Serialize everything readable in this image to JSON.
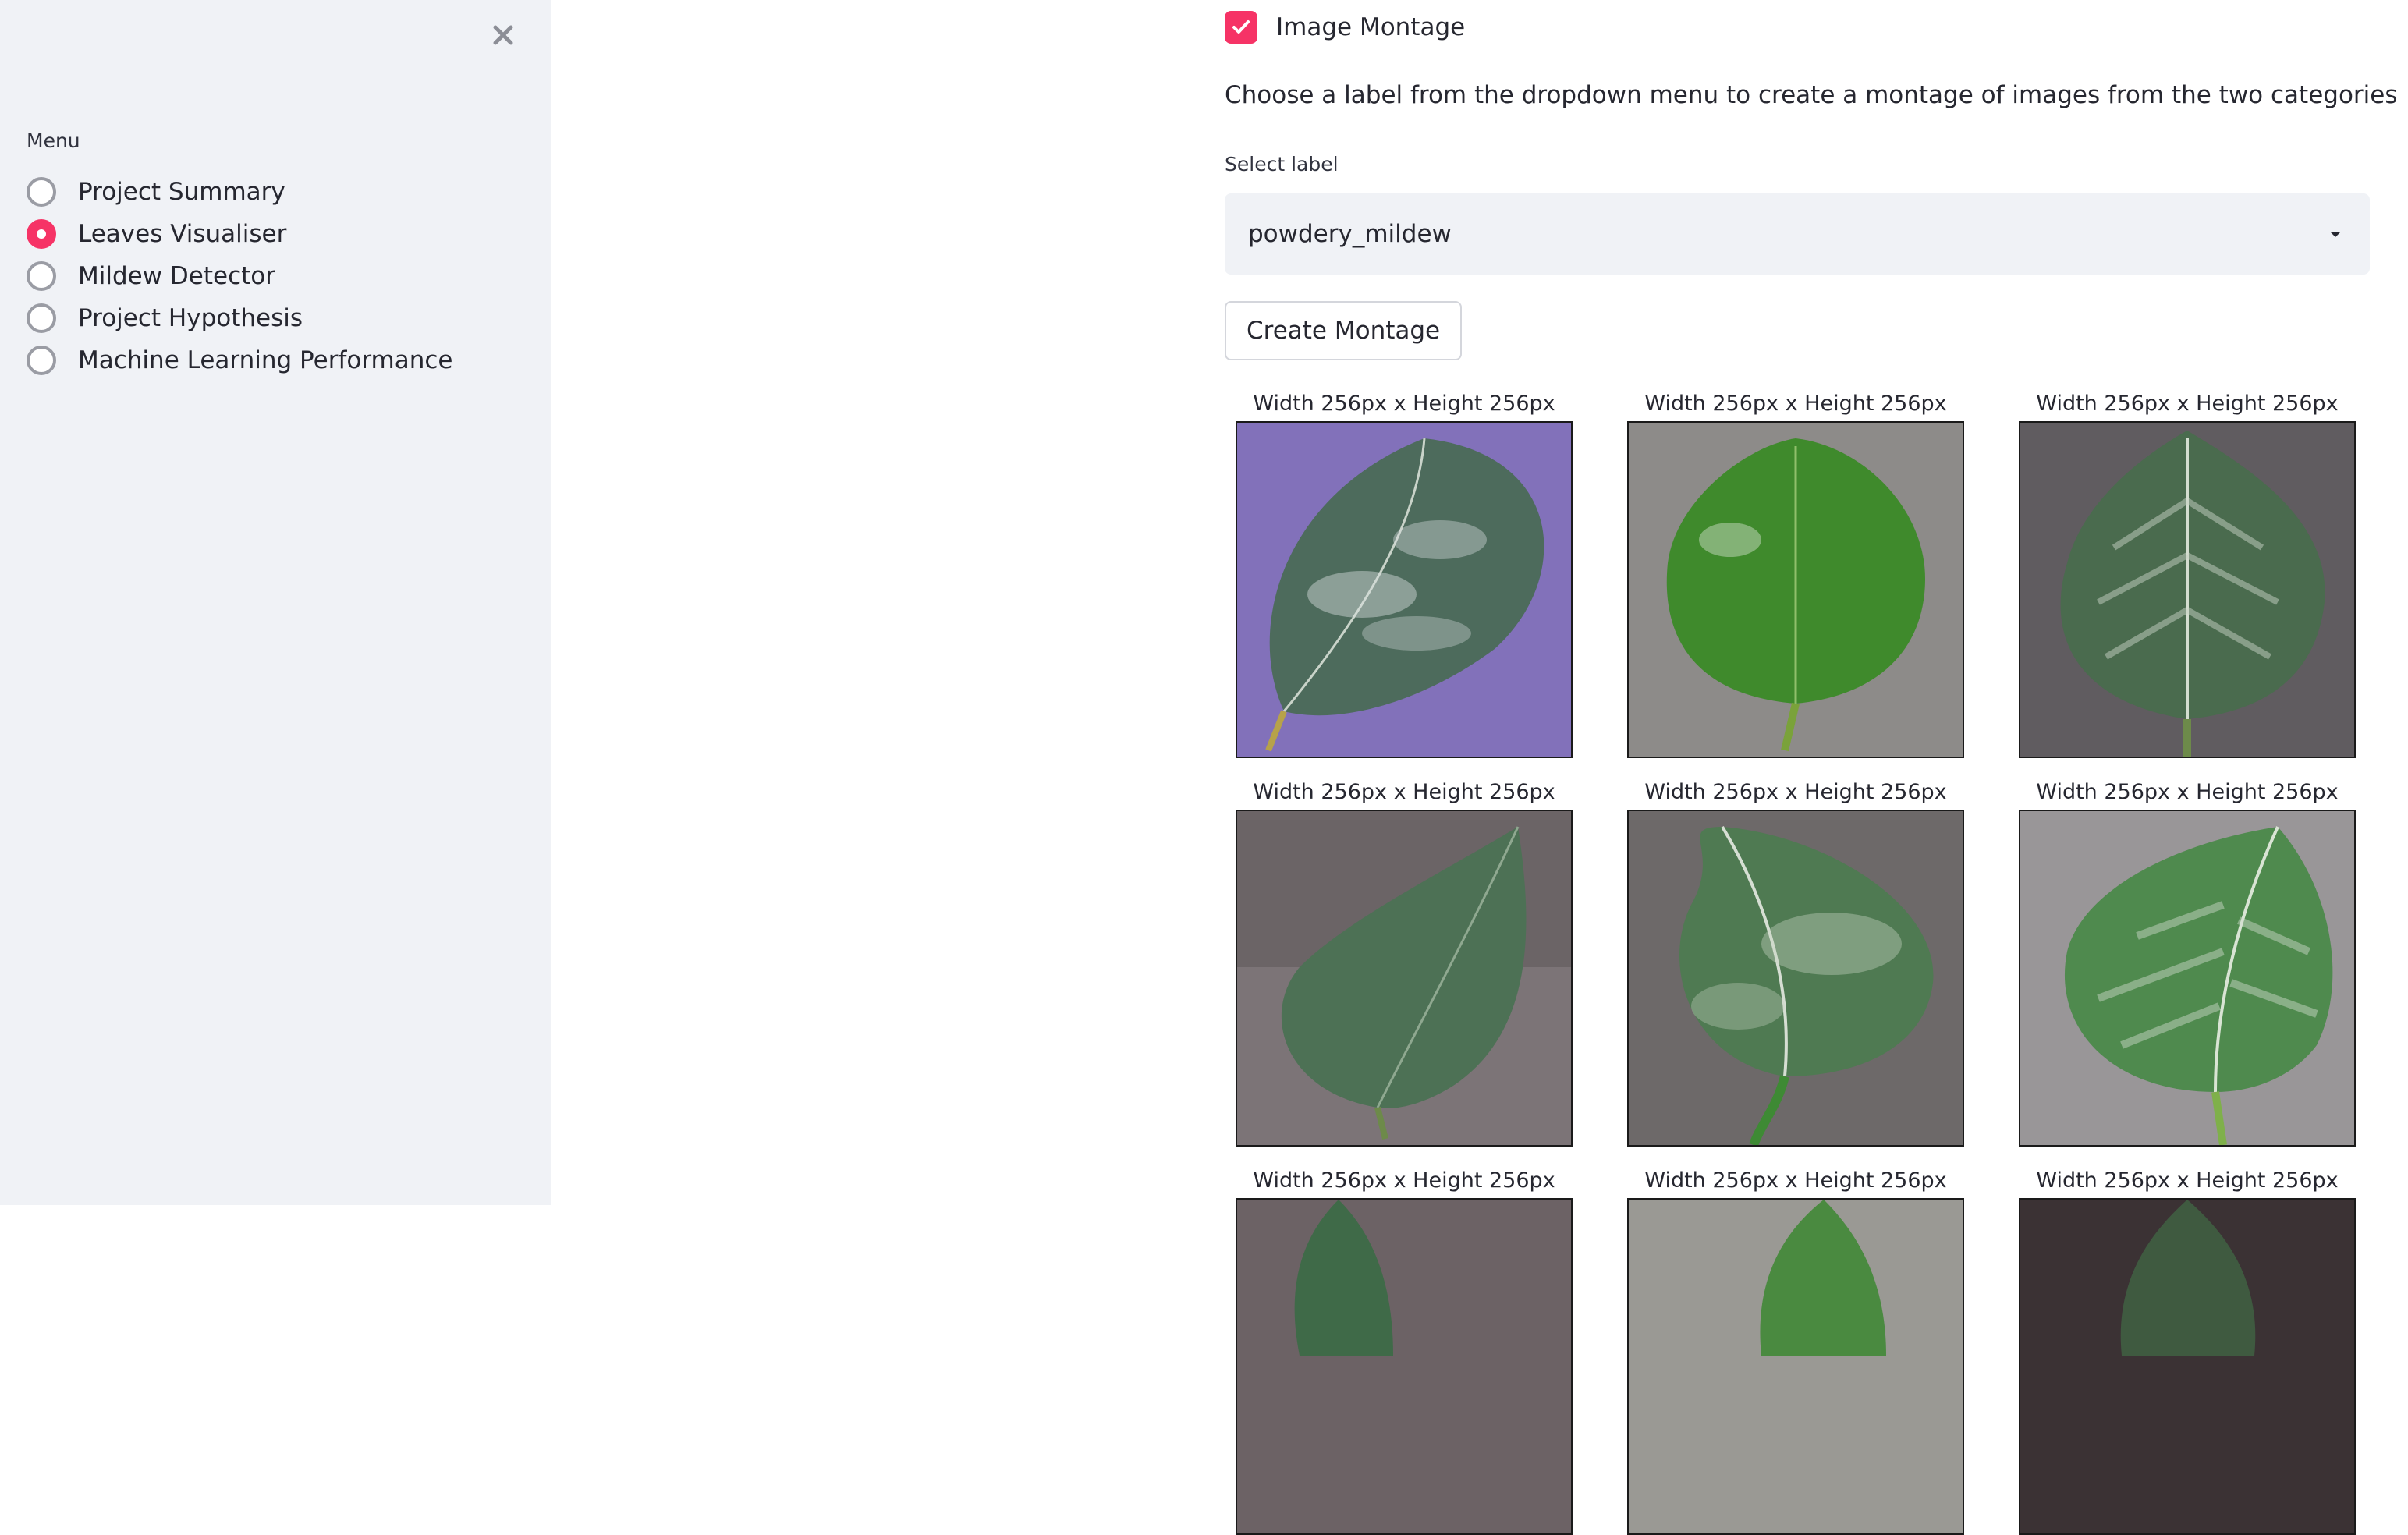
{
  "sidebar": {
    "close_icon": "close-icon",
    "menu_label": "Menu",
    "items": [
      {
        "label": "Project Summary",
        "selected": false
      },
      {
        "label": "Leaves Visualiser",
        "selected": true
      },
      {
        "label": "Mildew Detector",
        "selected": false
      },
      {
        "label": "Project Hypothesis",
        "selected": false
      },
      {
        "label": "Machine Learning Performance",
        "selected": false
      }
    ]
  },
  "main": {
    "checkbox": {
      "label": "Image Montage",
      "checked": true
    },
    "description": "Choose a label from the dropdown menu to create a montage of images from the two categories",
    "select": {
      "label": "Select label",
      "value": "powdery_mildew"
    },
    "button_label": "Create Montage",
    "montage": {
      "caption": "Width 256px x Height 256px",
      "images": [
        {
          "caption": "Width 256px x Height 256px"
        },
        {
          "caption": "Width 256px x Height 256px"
        },
        {
          "caption": "Width 256px x Height 256px"
        },
        {
          "caption": "Width 256px x Height 256px"
        },
        {
          "caption": "Width 256px x Height 256px"
        },
        {
          "caption": "Width 256px x Height 256px"
        },
        {
          "caption": "Width 256px x Height 256px"
        },
        {
          "caption": "Width 256px x Height 256px"
        },
        {
          "caption": "Width 256px x Height 256px"
        }
      ]
    }
  },
  "colors": {
    "accent": "#f63366",
    "sidebar_bg": "#f0f2f6",
    "text": "#262730"
  }
}
